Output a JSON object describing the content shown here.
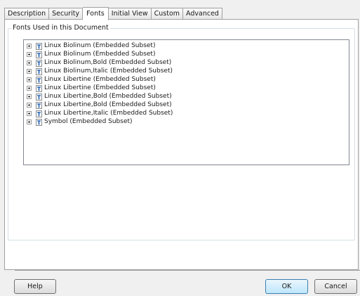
{
  "tabs": [
    {
      "label": "Description",
      "active": false
    },
    {
      "label": "Security",
      "active": false
    },
    {
      "label": "Fonts",
      "active": true
    },
    {
      "label": "Initial View",
      "active": false
    },
    {
      "label": "Custom",
      "active": false
    },
    {
      "label": "Advanced",
      "active": false
    }
  ],
  "group": {
    "title": "Fonts Used in this Document"
  },
  "fonts": [
    {
      "label": "Linux Biolinum (Embedded Subset)",
      "icon": "truetype-font-icon"
    },
    {
      "label": "Linux Biolinum (Embedded Subset)",
      "icon": "truetype-font-icon"
    },
    {
      "label": "Linux Biolinum,Bold (Embedded Subset)",
      "icon": "truetype-font-icon"
    },
    {
      "label": "Linux Biolinum,Italic (Embedded Subset)",
      "icon": "truetype-font-icon"
    },
    {
      "label": "Linux Libertine (Embedded Subset)",
      "icon": "truetype-font-icon"
    },
    {
      "label": "Linux Libertine (Embedded Subset)",
      "icon": "truetype-font-icon"
    },
    {
      "label": "Linux Libertine,Bold (Embedded Subset)",
      "icon": "truetype-font-icon"
    },
    {
      "label": "Linux Libertine,Bold (Embedded Subset)",
      "icon": "truetype-font-icon"
    },
    {
      "label": "Linux Libertine,Italic (Embedded Subset)",
      "icon": "truetype-font-icon"
    },
    {
      "label": "Symbol (Embedded Subset)",
      "icon": "truetype-font-icon"
    }
  ],
  "buttons": {
    "help": "Help",
    "ok": "OK",
    "cancel": "Cancel"
  },
  "colors": {
    "panel_background": "#ffffff",
    "dialog_background": "#f0f0f0",
    "font_icon_blue": "#1f5fb4",
    "ok_border": "#3c7fb1"
  }
}
